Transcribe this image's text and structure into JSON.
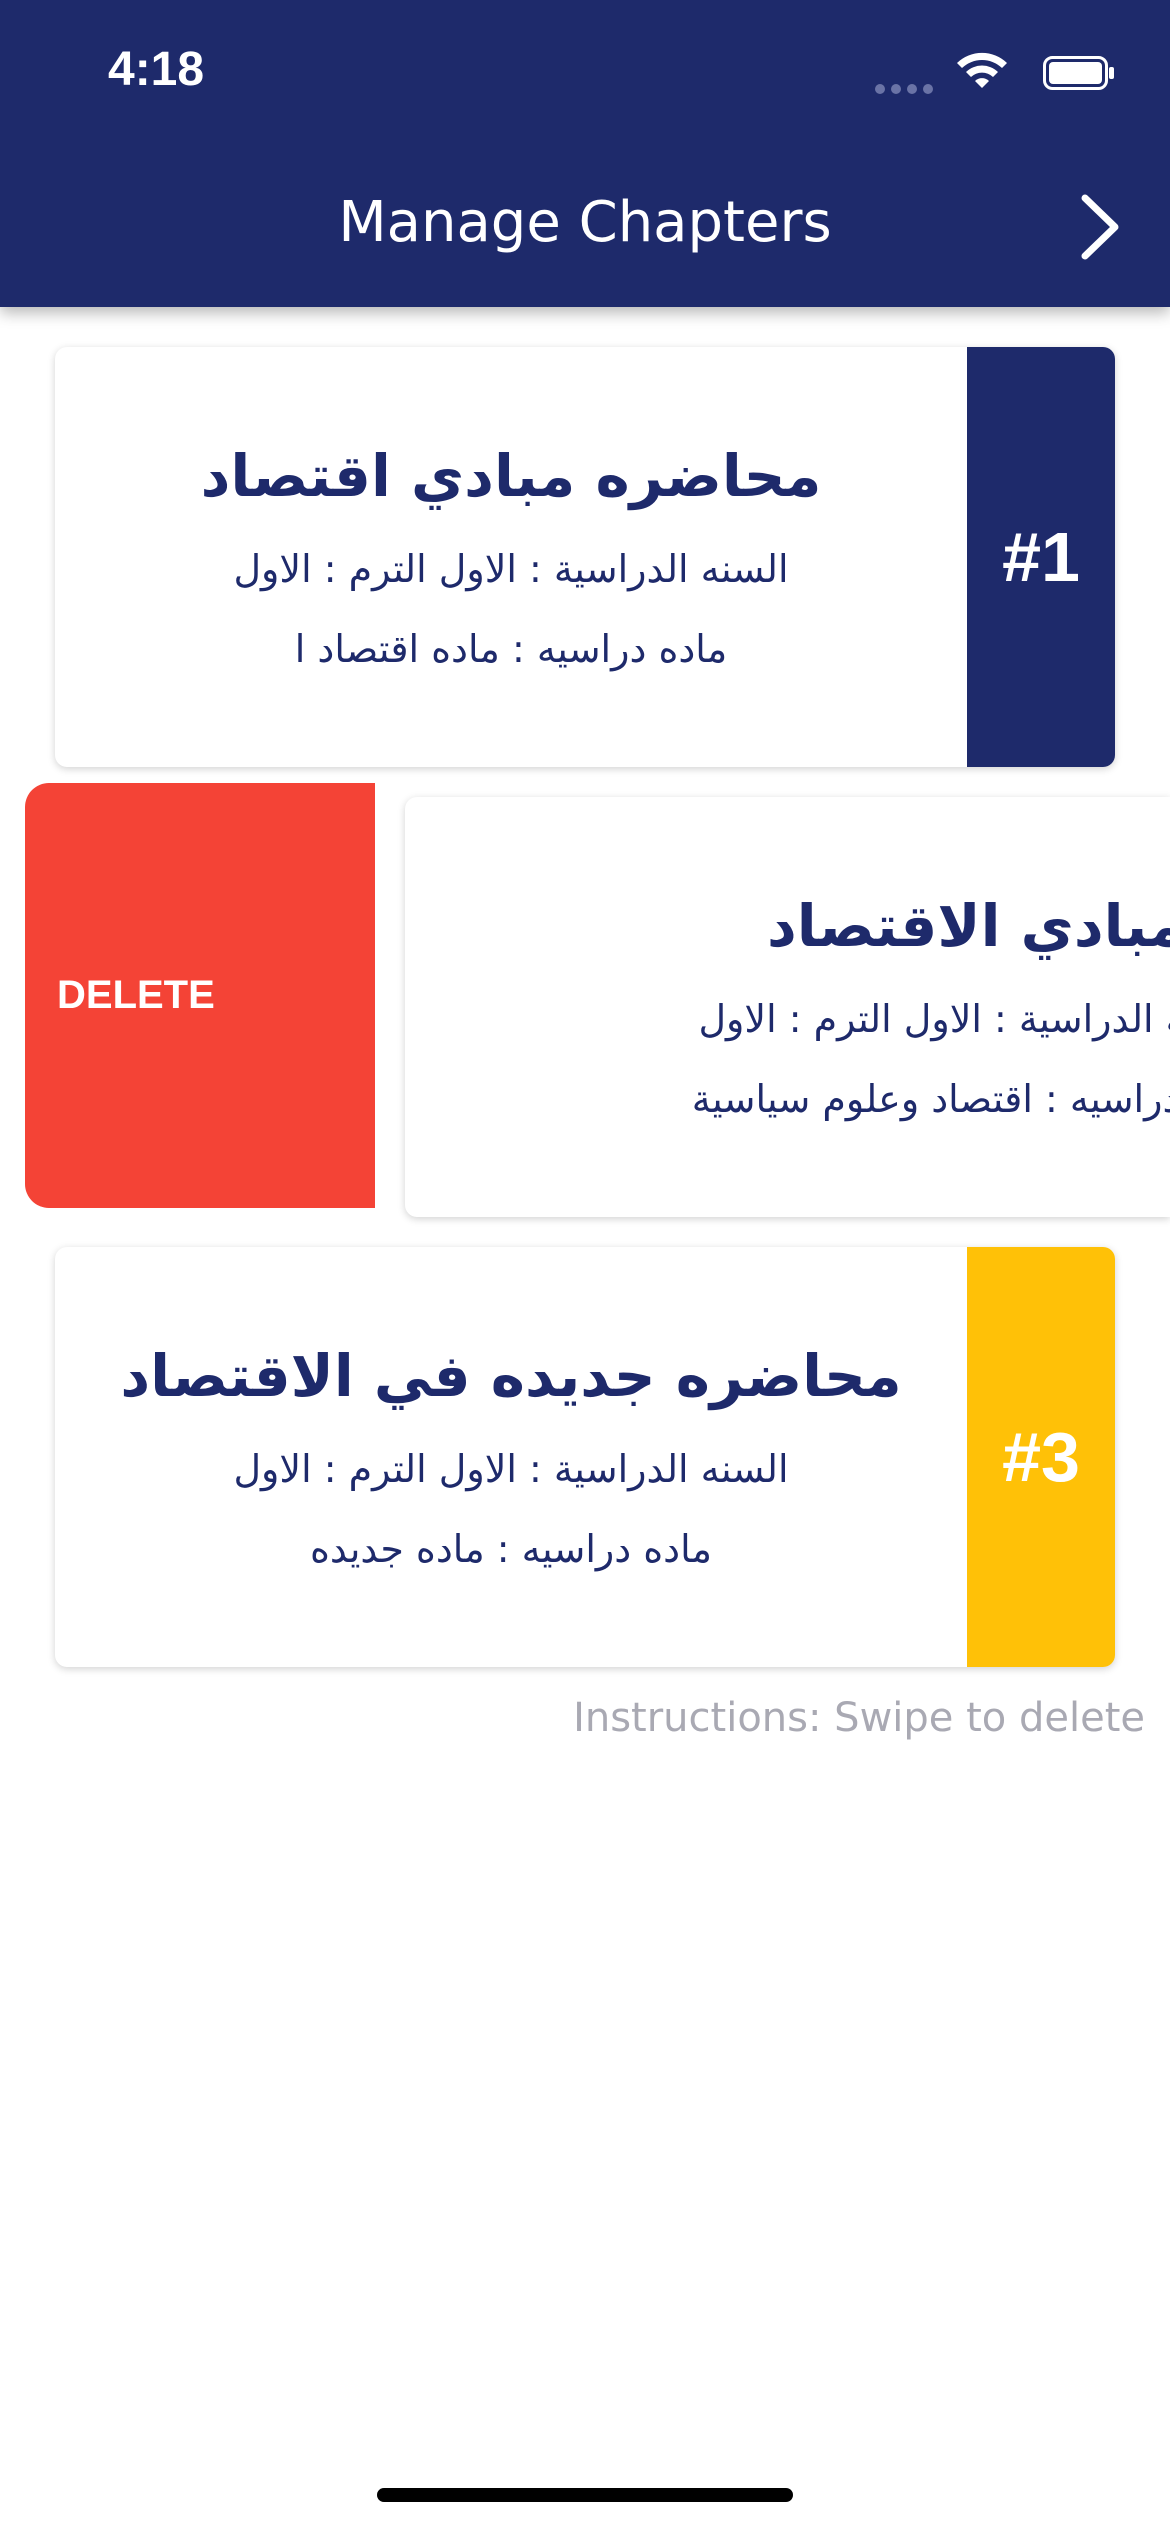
{
  "status_bar": {
    "time": "4:18"
  },
  "header": {
    "title": "Manage Chapters",
    "next_icon": "chevron-right-icon"
  },
  "chapters": [
    {
      "number": "#1",
      "badge_color": "#1e2a6b",
      "title": "محاضره مبادي اقتصاد",
      "line1": "السنه الدراسية : الاول الترم : الاول",
      "line2": "ماده دراسيه : ماده اقتصاد ا"
    },
    {
      "number": "",
      "badge_color": "",
      "title": "مبادي الاقتصاد",
      "line1": "السنه الدراسية : الاول الترم : الاول",
      "line2": "ماده دراسيه : اقتصاد وعلوم سياسية"
    },
    {
      "number": "#3",
      "badge_color": "#ffc107",
      "title": "محاضره جديده في الاقتصاد",
      "line1": "السنه الدراسية : الاول الترم : الاول",
      "line2": "ماده دراسيه : ماده جديده"
    }
  ],
  "swipe_action": {
    "label": "DELETE",
    "color": "#f44336"
  },
  "instructions": "Instructions: Swipe to delete"
}
